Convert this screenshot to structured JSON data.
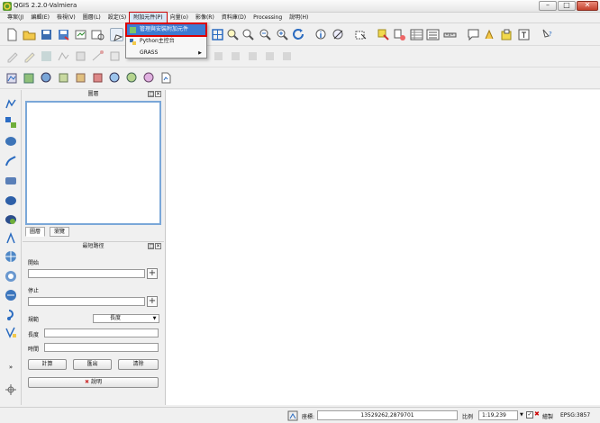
{
  "window": {
    "title": "QGIS 2.2.0-Valmiera"
  },
  "menubar": {
    "items": [
      "專案(J)",
      "編輯(E)",
      "檢視(V)",
      "圖層(L)",
      "設定(S)",
      "附加元件(P)",
      "向量(o)",
      "影像(R)",
      "資料庫(D)",
      "Processing",
      "說明(H)"
    ]
  },
  "plugin_menu": {
    "items": [
      {
        "label": "管理與安裝附加元件",
        "highlighted": true
      },
      {
        "label": "Python主控台",
        "highlighted": false
      },
      {
        "label": "GRASS",
        "submenu": true
      }
    ]
  },
  "layers_panel": {
    "title": "圖層",
    "float_glyph": "◫",
    "close_glyph": "✕",
    "tabs": [
      "圖層",
      "瀏覽"
    ]
  },
  "path_panel": {
    "title": "最短路徑",
    "start_label": "開始",
    "stop_label": "停止",
    "criterion_label": "規範",
    "criterion_value": "長度",
    "criterion_arrow": "▼",
    "plus_glyph": "+",
    "length_label": "長度",
    "time_label": "時間",
    "calculate_button": "計算",
    "export_button": "匯出",
    "clear_button": "清除",
    "help_button": "說明",
    "help_icon_glyph": "✖"
  },
  "statusbar": {
    "coord_label": "座標:",
    "coordinates": "13529262,2879701",
    "scale_label": "比例",
    "scale_value": "1:19,239",
    "render_label": "繪製",
    "crs": "EPSG:3857"
  },
  "window_buttons": {
    "minimize": "–",
    "maximize": "□",
    "close": "✕"
  },
  "colors": {
    "accent": "#3d7bd2",
    "highlight_border": "#dd0000",
    "panel_border": "#7aa7d8"
  }
}
